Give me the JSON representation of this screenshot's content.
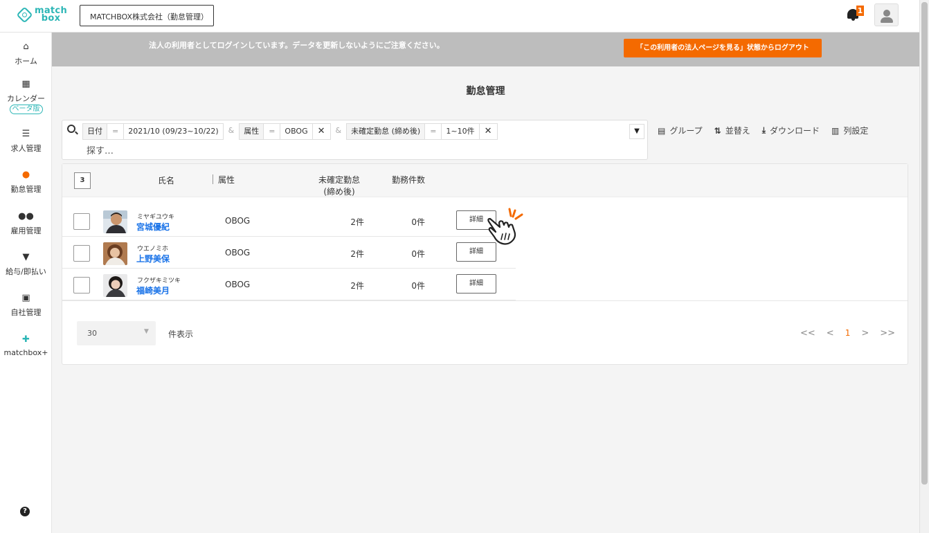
{
  "header": {
    "logo_line1": "match",
    "logo_line2": "box",
    "company": "MATCHBOX株式会社（勤怠管理）",
    "notification_count": "1"
  },
  "sidebar": {
    "items": [
      {
        "label": "ホーム",
        "icon": "home-icon"
      },
      {
        "label": "カレンダー",
        "badge": "ベータ版",
        "icon": "calendar-icon"
      },
      {
        "label": "求人管理",
        "icon": "list-icon"
      },
      {
        "label": "勤怠管理",
        "icon": "attendance-icon"
      },
      {
        "label": "雇用管理",
        "icon": "users-icon"
      },
      {
        "label": "給与/即払い",
        "icon": "payment-icon"
      },
      {
        "label": "自社管理",
        "icon": "building-icon"
      },
      {
        "label": "matchbox+",
        "icon": "plus-icon"
      }
    ],
    "help": "?"
  },
  "banner": {
    "text": "法人の利用者としてログインしています。データを更新しないようにご注意ください。",
    "logout_button": "「この利用者の法人ページを見る」状態からログアウト"
  },
  "page_title": "勤怠管理",
  "filter": {
    "chips": [
      {
        "text": "日付",
        "kind": "key"
      },
      {
        "text": "=",
        "kind": "op"
      },
      {
        "text": "2021/10 (09/23~10/22)",
        "kind": "value"
      },
      {
        "text": "&",
        "kind": "amp"
      },
      {
        "text": "属性",
        "kind": "key"
      },
      {
        "text": "=",
        "kind": "op"
      },
      {
        "text": "OBOG",
        "kind": "value"
      },
      {
        "text": "✕",
        "kind": "x"
      },
      {
        "text": "&",
        "kind": "amp"
      },
      {
        "text": "未確定勤怠 (締め後)",
        "kind": "key"
      },
      {
        "text": "=",
        "kind": "op"
      },
      {
        "text": "1~10件",
        "kind": "value"
      },
      {
        "text": "✕",
        "kind": "x"
      }
    ],
    "placeholder": "探す…"
  },
  "tools": [
    {
      "label": "グループ",
      "icon": "group-icon"
    },
    {
      "label": "並替え",
      "icon": "sort-icon"
    },
    {
      "label": "ダウンロード",
      "icon": "download-icon"
    },
    {
      "label": "列設定",
      "icon": "columns-icon"
    }
  ],
  "table": {
    "count": "3",
    "headers": {
      "name": "氏名",
      "attr": "属性",
      "unconfirmed_line1": "未確定勤怠",
      "unconfirmed_line2": "(締め後)",
      "work_count": "勤務件数"
    },
    "rows": [
      {
        "kana": "ミヤギユウキ",
        "name": "宮城優紀",
        "attr": "OBOG",
        "unconfirmed": "2件",
        "work": "0件",
        "detail": "詳細"
      },
      {
        "kana": "ウエノミホ",
        "name": "上野美保",
        "attr": "OBOG",
        "unconfirmed": "2件",
        "work": "0件",
        "detail": "詳細"
      },
      {
        "kana": "フクザキミツキ",
        "name": "福崎美月",
        "attr": "OBOG",
        "unconfirmed": "2件",
        "work": "0件",
        "detail": "詳細"
      }
    ]
  },
  "pagination": {
    "per_page": "30",
    "per_page_label": "件表示",
    "first": "<<",
    "prev": "<",
    "current": "1",
    "next": ">",
    "last": ">>"
  },
  "colors": {
    "accent": "#f46a00",
    "brand": "#2cb6b6",
    "link": "#1a73e8"
  }
}
